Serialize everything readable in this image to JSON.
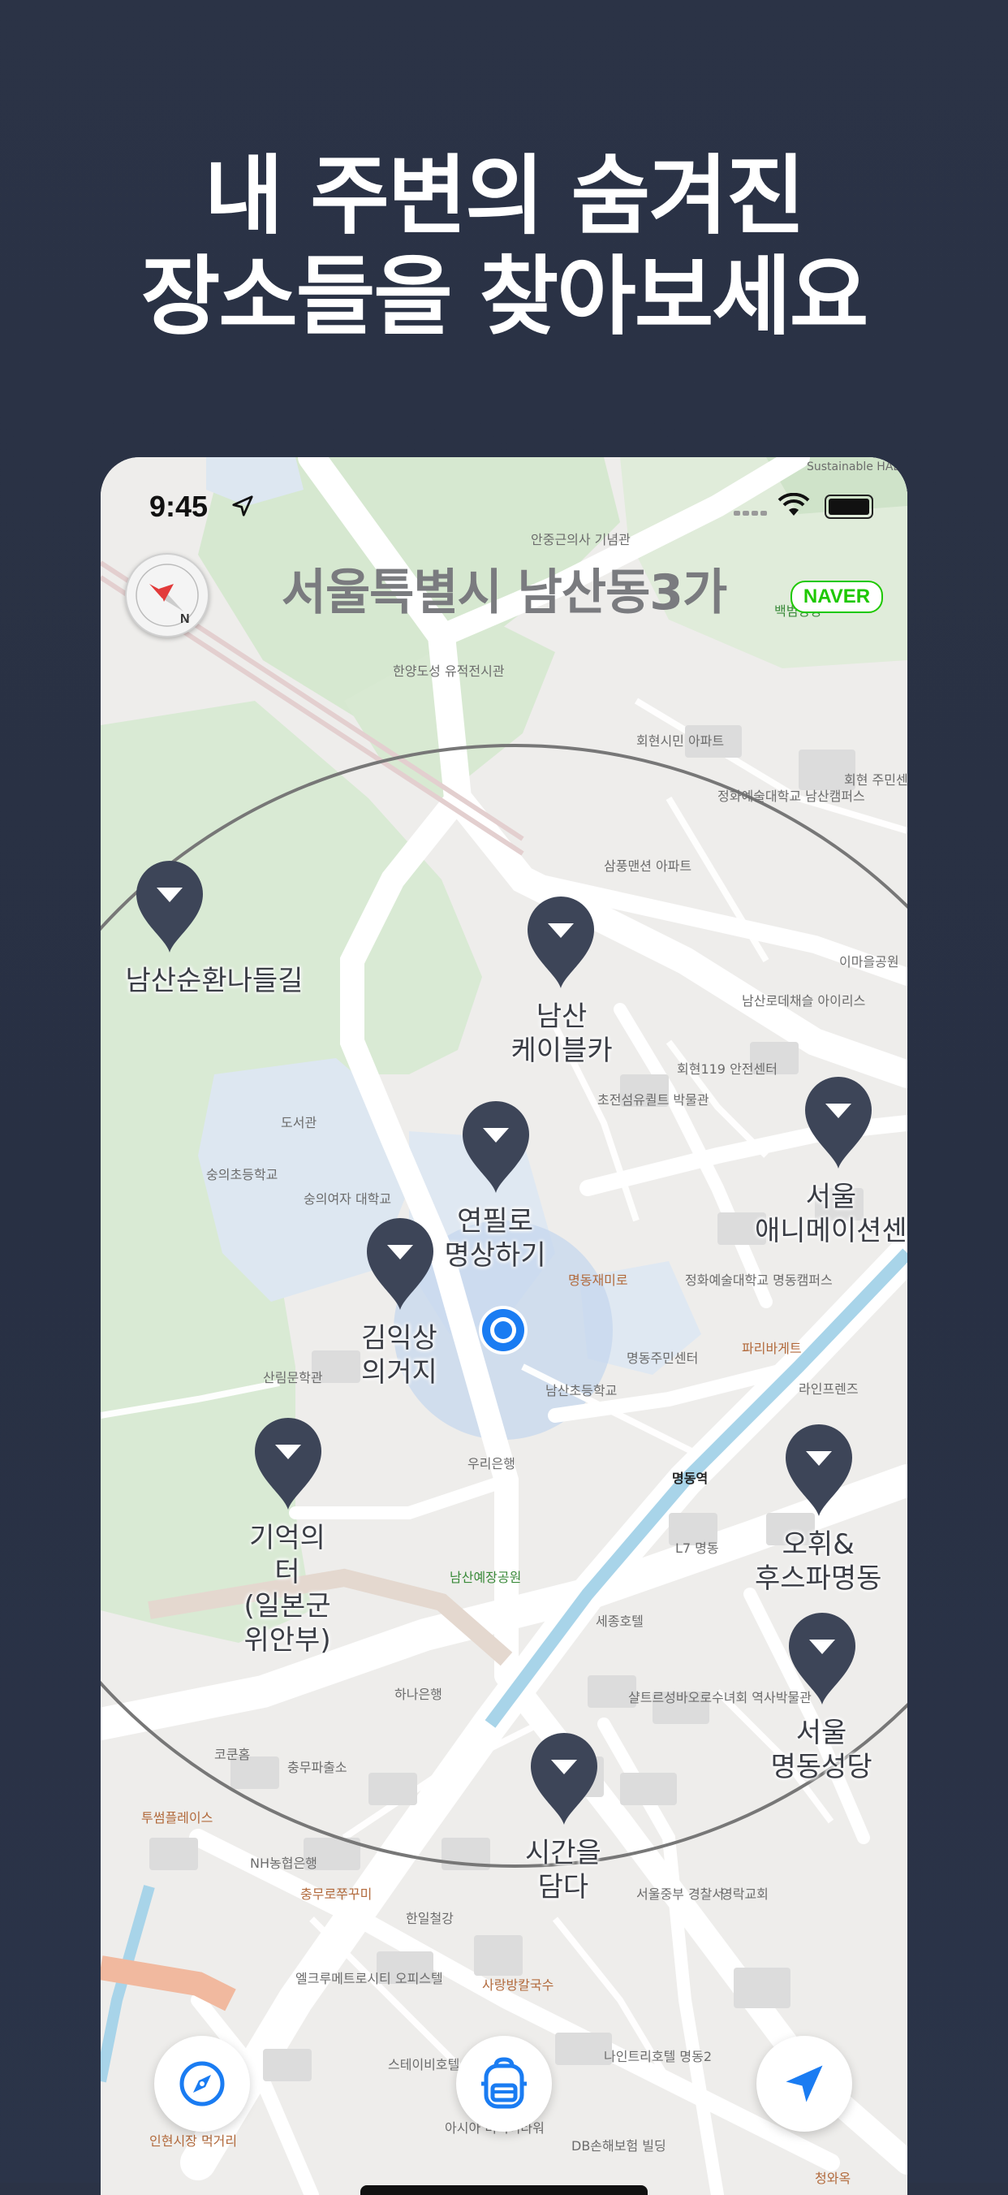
{
  "headline": {
    "line1": "내 주변의 숨겨진",
    "line2": "장소들을 찾아보세요"
  },
  "status_bar": {
    "time": "9:45"
  },
  "map": {
    "region_title": "서울특별시 남산동3가",
    "naver_badge": "NAVER",
    "background_labels": [
      "안중근의사 기념관",
      "한양도성 유적전시관",
      "회현시민 아파트",
      "정화예술대학교 남산캠퍼스",
      "삼풍맨션 아파트",
      "남산로데채슬 아이리스",
      "회현119 안전센터",
      "초전섬유퀼트 박물관",
      "숭의여자 대학교",
      "숭의초등학교",
      "도서관",
      "산림문학관",
      "명동재미로",
      "정화예술대학교 명동캠퍼스",
      "명동주민센터",
      "남산초등학교",
      "우리은행",
      "파리바게트",
      "라인프렌즈",
      "명동역",
      "L7 명동",
      "남산예장공원",
      "세종호텔",
      "샬트르성바오로수녀회 역사박물관",
      "하나은행",
      "코쿤홈",
      "충무파출소",
      "투썸플레이스",
      "NH농협은행",
      "충무로쭈꾸미",
      "한일철강",
      "엘크루메트로시티 오피스텔",
      "사랑방칼국수",
      "서울중부 경찰서",
      "영락교회",
      "스테이비호텔 명동",
      "나인트리호텔 명동2",
      "아시아 미디어타워",
      "DB손해보험 빌딩",
      "인현시장 먹거리",
      "청와옥",
      "백범광장",
      "회현 주민센",
      "이마을공원",
      "Sustainable HABITs"
    ]
  },
  "places": [
    {
      "name": "남산순환나들길"
    },
    {
      "name": "남산\n케이블카"
    },
    {
      "name": "서울\n애니메이션센"
    },
    {
      "name": "연필로\n명상하기"
    },
    {
      "name": "김익상\n의거지"
    },
    {
      "name": "기억의\n터\n(일본군\n위안부)"
    },
    {
      "name": "오휘&\n후스파명동"
    },
    {
      "name": "서울\n명동성당"
    },
    {
      "name": "시간을\n담다"
    }
  ],
  "colors": {
    "background": "#2b3346",
    "pin": "#3d4558",
    "accent_blue": "#1a7cf2",
    "naver_green": "#1ec800"
  },
  "icons": {
    "explore_button": "compass-icon",
    "collection_button": "backpack-icon",
    "locate_button": "navigation-arrow-icon"
  }
}
